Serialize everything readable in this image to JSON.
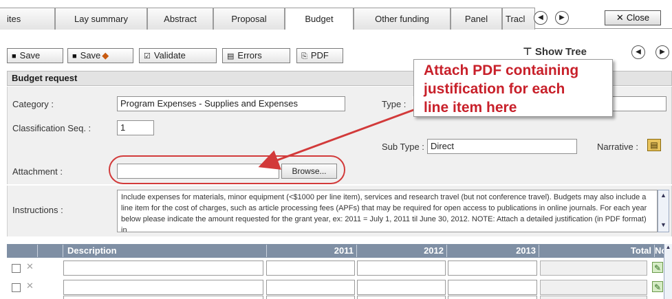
{
  "tabs": [
    {
      "label": "ites"
    },
    {
      "label": "Lay summary"
    },
    {
      "label": "Abstract"
    },
    {
      "label": "Proposal"
    },
    {
      "label": "Budget"
    },
    {
      "label": "Other funding"
    },
    {
      "label": "Panel"
    },
    {
      "label": "Tracl"
    }
  ],
  "active_tab": "Budget",
  "close_label": "Close",
  "toolbar": {
    "save": "Save",
    "save_plus": "Save",
    "validate": "Validate",
    "errors": "Errors",
    "pdf": "PDF",
    "show_tree": "Show Tree"
  },
  "form": {
    "section_title": "Budget request",
    "category_label": "Category :",
    "category_value": "Program Expenses - Supplies and Expenses",
    "type_label": "Type :",
    "classification_label": "Classification Seq. :",
    "classification_value": "1",
    "subtype_label": "Sub Type :",
    "subtype_value": "Direct",
    "narrative_label": "Narrative :",
    "attachment_label": "Attachment :",
    "browse_label": "Browse...",
    "instructions_label": "Instructions :",
    "instructions_text": "Include expenses for materials, minor equipment (<$1000 per line item), services and research travel (but not conference travel). Budgets may also include a line item for the cost of charges, such as article processing fees (APFs) that may be required for open access to publications in online journals. For each year below please indicate the amount requested for the grant year, ex: 2011 = July 1, 2011 til June 30, 2012. NOTE: Attach a detailed justification (in PDF format) in"
  },
  "grid": {
    "headers": {
      "description": "Description",
      "y1": "2011",
      "y2": "2012",
      "y3": "2013",
      "total": "Total",
      "notes": "Notes"
    },
    "row_count": 3
  },
  "annotation": {
    "line1": "Attach PDF containing",
    "line2": "justification for each",
    "line3": "line item here",
    "color": "#c8202a"
  }
}
